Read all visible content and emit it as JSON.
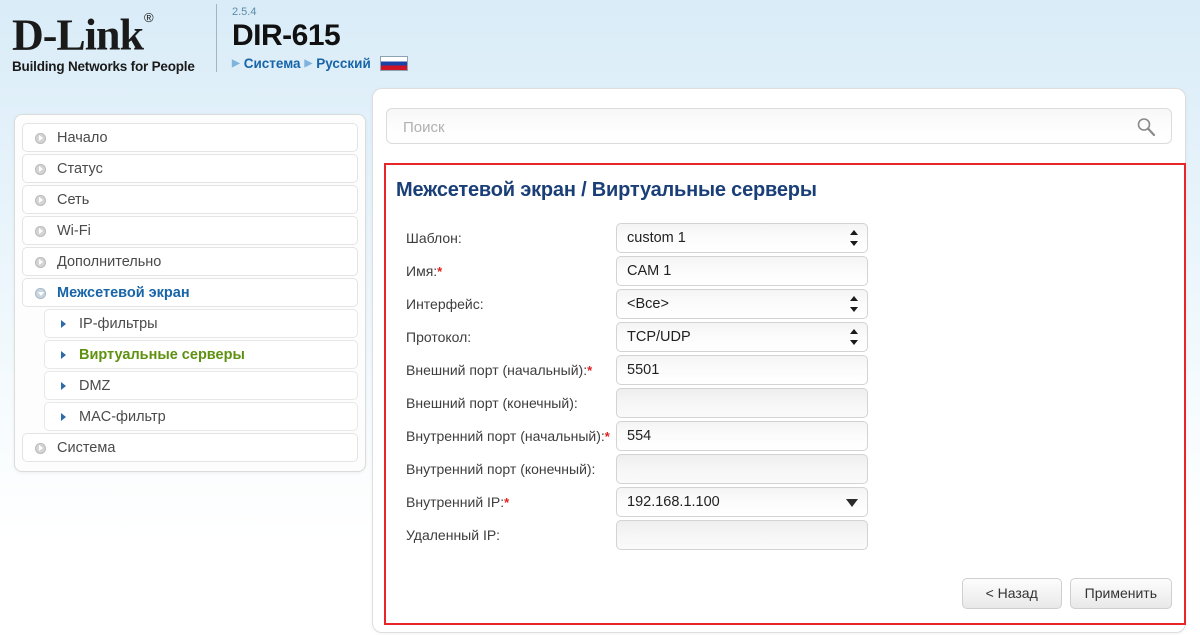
{
  "header": {
    "logo_text": "D-Link",
    "logo_reg": "®",
    "logo_tagline": "Building Networks for People",
    "version": "2.5.4",
    "model": "DIR-615",
    "nav": [
      {
        "label": "Система"
      },
      {
        "label": "Русский"
      }
    ],
    "flag_icon": "russian-flag-icon"
  },
  "sidebar": {
    "items": [
      {
        "label": "Начало",
        "type": "top",
        "state": "normal"
      },
      {
        "label": "Статус",
        "type": "top",
        "state": "normal"
      },
      {
        "label": "Сеть",
        "type": "top",
        "state": "normal"
      },
      {
        "label": "Wi-Fi",
        "type": "top",
        "state": "normal"
      },
      {
        "label": "Дополнительно",
        "type": "top",
        "state": "normal"
      },
      {
        "label": "Межсетевой экран",
        "type": "top",
        "state": "expanded"
      },
      {
        "label": "IP-фильтры",
        "type": "sub",
        "state": "normal"
      },
      {
        "label": "Виртуальные серверы",
        "type": "sub",
        "state": "active"
      },
      {
        "label": "DMZ",
        "type": "sub",
        "state": "normal"
      },
      {
        "label": "MAC-фильтр",
        "type": "sub",
        "state": "normal"
      },
      {
        "label": "Система",
        "type": "top",
        "state": "normal"
      }
    ]
  },
  "search": {
    "placeholder": "Поиск",
    "value": "",
    "icon": "search-icon"
  },
  "content": {
    "title": "Межсетевой экран /  Виртуальные серверы",
    "border_color": "#e8262a",
    "title_color": "#1a3f77"
  },
  "form": {
    "fields": [
      {
        "label": "Шаблон:",
        "required": false,
        "kind": "select",
        "value": "custom 1"
      },
      {
        "label": "Имя:",
        "required": true,
        "kind": "text",
        "value": "CAM 1"
      },
      {
        "label": "Интерфейс:",
        "required": false,
        "kind": "select",
        "value": "<Все>"
      },
      {
        "label": "Протокол:",
        "required": false,
        "kind": "select",
        "value": "TCP/UDP"
      },
      {
        "label": "Внешний порт (начальный):",
        "required": true,
        "kind": "text",
        "value": "5501"
      },
      {
        "label": "Внешний порт (конечный):",
        "required": false,
        "kind": "text",
        "value": ""
      },
      {
        "label": "Внутренний порт (начальный):",
        "required": true,
        "kind": "text",
        "value": "554",
        "wrap": true
      },
      {
        "label": "Внутренний порт (конечный):",
        "required": false,
        "kind": "text",
        "value": ""
      },
      {
        "label": "Внутренний IP:",
        "required": true,
        "kind": "combo",
        "value": "192.168.1.100"
      },
      {
        "label": "Удаленный IP:",
        "required": false,
        "kind": "text",
        "value": ""
      }
    ]
  },
  "buttons": {
    "back": "< Назад",
    "apply": "Применить"
  }
}
